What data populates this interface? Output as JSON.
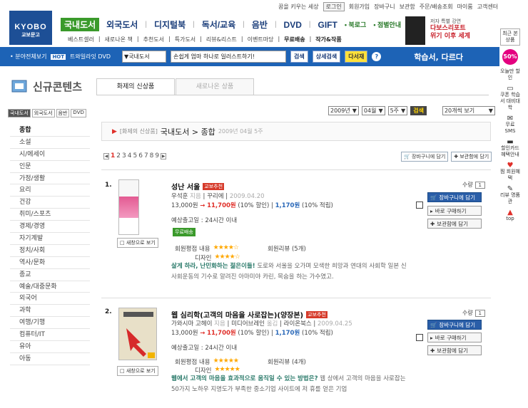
{
  "topbar": {
    "links": [
      "꿈을 키우는 세상",
      "로그인",
      "회원가입",
      "장바구니",
      "보관함",
      "주문/배송조회",
      "마이룸",
      "고객센터"
    ]
  },
  "logo": {
    "name": "KYOBO",
    "sub": "교보문고"
  },
  "gnb": {
    "items": [
      "국내도서",
      "외국도서",
      "디지털북",
      "독서/교육",
      "음반",
      "DVD",
      "GIFT"
    ],
    "extra": [
      "북로그",
      "점별안내"
    ]
  },
  "subnav": [
    "베스트셀러",
    "새로나온 책",
    "추천도서",
    "특가도서",
    "리뷰&리스트",
    "이벤트마당",
    "무료배송",
    "작가&작품"
  ],
  "promo": {
    "line1": "저자 특별 강연",
    "line2": "다보스리포트",
    "line3": "위기 이후 세계"
  },
  "searchbar": {
    "category_link": "분야전체보기",
    "hot_label": "HOT",
    "hot_text": "트와일라잇 DVD",
    "select": "국내도서",
    "query": "손쉽게 엄마 하나로 일러스트하기!",
    "search_btn": "검색",
    "detail_btn": "상세검색",
    "multi_btn": "다서재",
    "help": "?",
    "study": "학습서, 다르다"
  },
  "right_sidebar": {
    "top": "최근 본 상품",
    "pct": "50%",
    "items": [
      "오늘만 할인",
      "쿠폰 학습서 대비대학",
      "무료 SMS",
      "할인카드 혜택안내",
      "찜 회원혜택",
      "리뷰 명품관",
      "top"
    ]
  },
  "page": {
    "title": "신규콘텐츠"
  },
  "tabs": [
    "화제의 신상품",
    "새로나온 상품"
  ],
  "category_tabs": [
    "국내도서",
    "외국도서",
    "음반",
    "DVD"
  ],
  "categories": [
    "종합",
    "소설",
    "시/에세이",
    "인문",
    "가정/생활",
    "요리",
    "건강",
    "취미/스포츠",
    "경제/경영",
    "자기계발",
    "정치/사회",
    "역사/문화",
    "종교",
    "예술/대중문화",
    "외국어",
    "과학",
    "여행/기행",
    "컴퓨터/IT",
    "유아",
    "아동"
  ],
  "filters": {
    "year": "2009년",
    "month": "04월",
    "week": "5주",
    "go": "검색",
    "view": "20개씩 보기"
  },
  "breadcrumb": {
    "prefix": "[화제의 신상품]",
    "main": "국내도서 > 종합",
    "date": "2009년 04월 5주"
  },
  "pagination": {
    "pages": [
      "1",
      "2",
      "3",
      "4",
      "5",
      "6",
      "7",
      "8",
      "9"
    ],
    "current": "1"
  },
  "list_actions": {
    "cart_all": "장바구니에 담기",
    "keep_all": "보관함에 담기"
  },
  "products": [
    {
      "rank": "1.",
      "title": "성난 서울",
      "badge": "교보추천",
      "author": "우석훈",
      "author_role": "지음",
      "publisher": "꾸리에",
      "date": "2009.04.20",
      "list_price": "13,000원",
      "arrow": "→",
      "price": "11,700원",
      "discount": "(10% 할인)",
      "points": "1,170원",
      "points_rate": "(10% 적립)",
      "ship": "예상출고일 : 24시간 이내",
      "free": "무료배송",
      "rating_label": "회원평점 내용",
      "design_label": "디자인",
      "stars1": "★★★★☆",
      "stars2": "★★★★☆",
      "review_label": "회원리뷰",
      "review_count": "(5개)",
      "desc_hl": "살게 하라, 난민화하는 젊은이들!",
      "desc_rest": "도로와 서울을 오가며 모색한 희망과 연대의 사회학 일본 신사회운동의 기수로 알려진 아마미야 카린, 목숨을 하는 가수였고.",
      "preview": "새창으로 보기",
      "qty_label": "수량",
      "qty": "1",
      "cart": "장바구니에 담기",
      "buy": "바로 구매하기",
      "keep": "보관함에 담기"
    },
    {
      "rank": "2.",
      "title": "웹 심리학(고객의 마음을 사로잡는)(양장본)",
      "badge": "교보추천",
      "author": "가와시마 고헤이",
      "author_role": "지음",
      "publisher": "미디어브레인",
      "sub_publisher": "라이온북스",
      "date": "2009.04.25",
      "list_price": "13,000원",
      "arrow": "→",
      "price": "11,700원",
      "discount": "(10% 할인)",
      "points": "1,170원",
      "points_rate": "(10% 적립)",
      "ship": "예상출고일 : 24시간 이내",
      "rating_label": "회원평점 내용",
      "design_label": "디자인",
      "stars1": "★★★★★",
      "stars2": "★★★★★",
      "review_label": "회원리뷰",
      "review_count": "(4개)",
      "desc_hl": "웹에서 고객의 마음을 효과적으로 움직일 수 있는 방법은?",
      "desc_rest": "웹 상에서 고객의 마음을 사로잡는 50가지 노하우 지명도가 부족한 중소기업 사이트에 저 휴를 얻은 기업",
      "preview": "새창으로 보기",
      "qty_label": "수량",
      "qty": "1",
      "cart": "장바구니에 담기",
      "buy": "바로 구매하기",
      "keep": "보관함에 담기"
    }
  ]
}
